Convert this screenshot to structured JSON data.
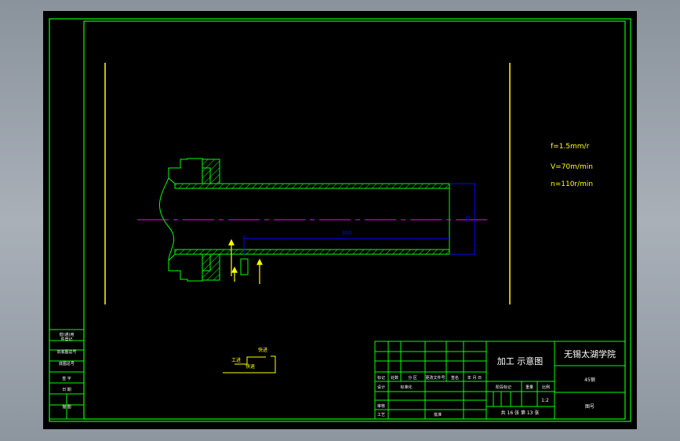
{
  "cutting_params": {
    "feed": "f=1.5mm/r",
    "speed": "V=70m/min",
    "rpm": "n=110r/min"
  },
  "dimensions": {
    "length": "300",
    "diameter": "50"
  },
  "inset_labels": {
    "work_in": "工进",
    "fast_in": "快进",
    "fast_out": "快退"
  },
  "title_block": {
    "drawing_name": "加工 示意图",
    "school": "无锡太湖学院",
    "material_ref": "45钢",
    "scale_value": "1:2",
    "sheet_info": "共 16 张  第 13 张",
    "note_cell": "图号",
    "header_labels": [
      "标记",
      "处数",
      "分 区",
      "更改文件号",
      "签名",
      "年 月 日"
    ],
    "design_labels": [
      "设计",
      "标准化"
    ],
    "stage_labels": [
      "阶段标记",
      "重量",
      "比例"
    ],
    "review_labels": [
      "审核"
    ],
    "process_labels": [
      "工艺",
      "批准"
    ]
  },
  "side_block": {
    "rows": [
      "借(通)用",
      "件登记",
      "旧底图总号",
      "底图总号",
      "签 字",
      "日 期",
      "描 图"
    ]
  },
  "colors": {
    "frame": "#00ff00",
    "part": "#00ff00",
    "centerline": "#ff00ff",
    "dimension": "#0000ff",
    "text": "#ffff00"
  }
}
